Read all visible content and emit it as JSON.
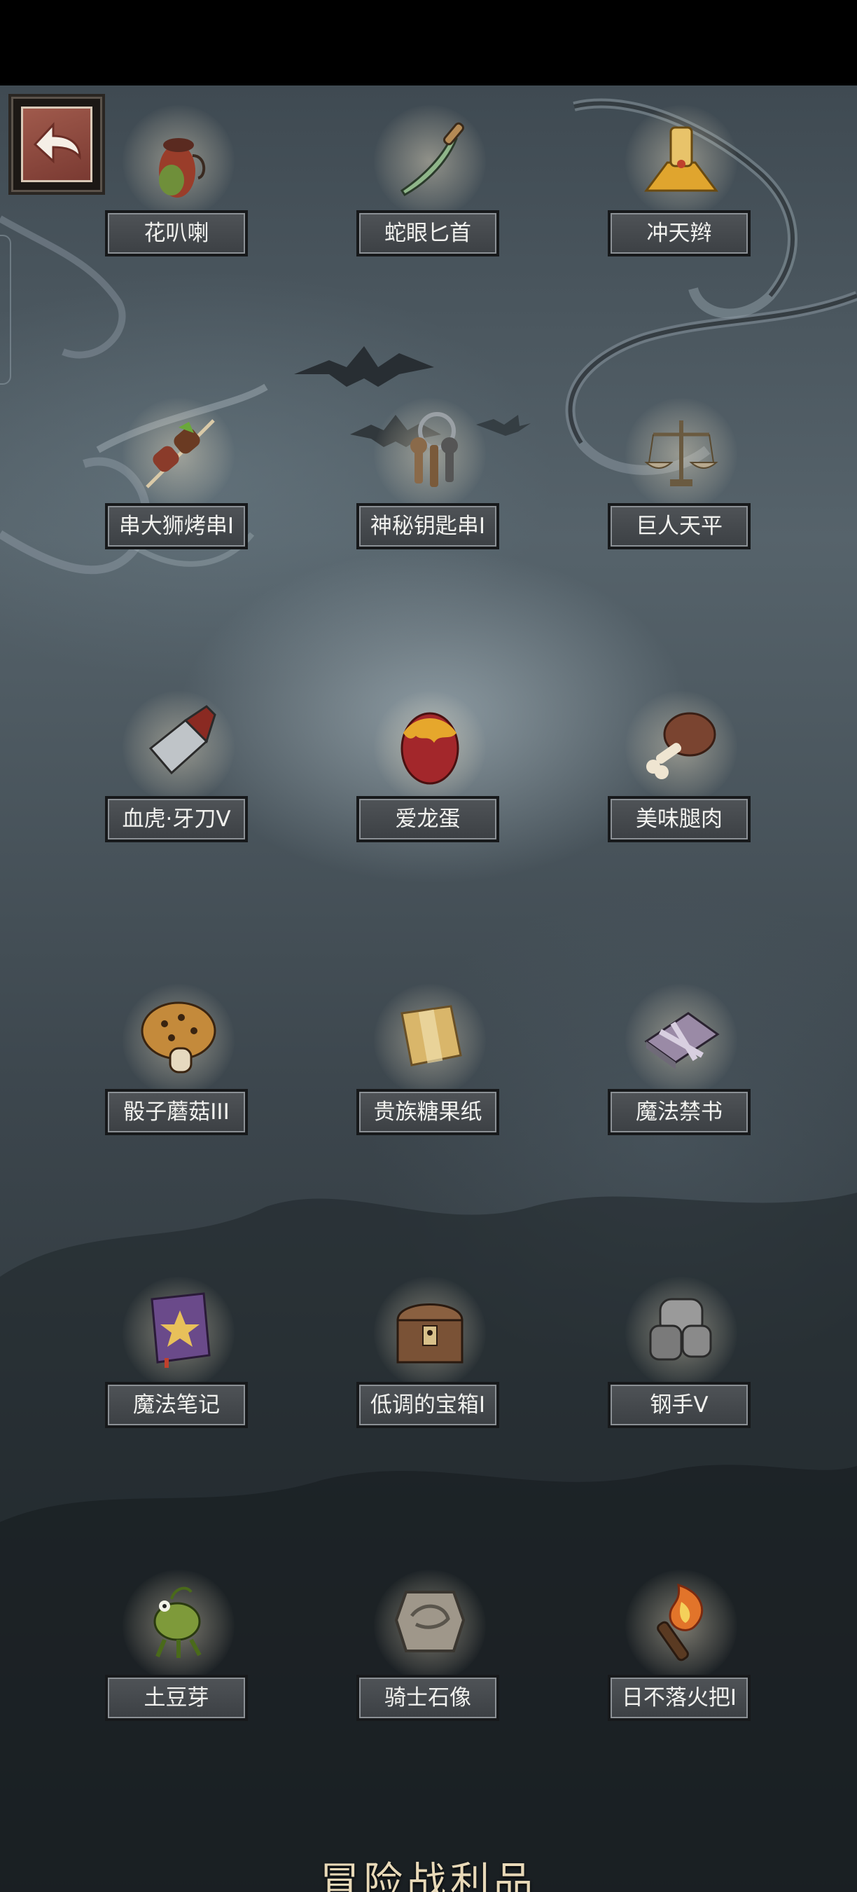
{
  "page": {
    "bottom_title": "冒险战利品"
  },
  "back_button": {
    "icon": "return-arrow-icon"
  },
  "items": [
    {
      "label": "花叭喇",
      "icon": "pitcher-plant-icon",
      "color": "#9a3d2a"
    },
    {
      "label": "蛇眼匕首",
      "icon": "dagger-icon",
      "color": "#8fb68a"
    },
    {
      "label": "冲天辫",
      "icon": "braid-icon",
      "color": "#e0a52e"
    },
    {
      "label": "串大狮烤串I",
      "icon": "skewer-icon",
      "color": "#8a3b2a"
    },
    {
      "label": "神秘钥匙串I",
      "icon": "keys-icon",
      "color": "#8a6a4a"
    },
    {
      "label": "巨人天平",
      "icon": "scales-icon",
      "color": "#b7a98f"
    },
    {
      "label": "血虎·牙刀V",
      "icon": "cleaver-icon",
      "color": "#bfc4c8"
    },
    {
      "label": "爱龙蛋",
      "icon": "dragon-egg-icon",
      "color": "#a3272b"
    },
    {
      "label": "美味腿肉",
      "icon": "meat-leg-icon",
      "color": "#7a4430"
    },
    {
      "label": "骰子蘑菇III",
      "icon": "mushroom-icon",
      "color": "#c48a3b"
    },
    {
      "label": "贵族糖果纸",
      "icon": "candy-wrapper-icon",
      "color": "#d9b66a"
    },
    {
      "label": "魔法禁书",
      "icon": "forbidden-book-icon",
      "color": "#9a8aa6"
    },
    {
      "label": "魔法笔记",
      "icon": "spellbook-icon",
      "color": "#6a4a8a"
    },
    {
      "label": "低调的宝箱I",
      "icon": "treasure-chest-icon",
      "color": "#7a5236"
    },
    {
      "label": "钢手V",
      "icon": "gauntlet-icon",
      "color": "#9a9a9a"
    },
    {
      "label": "土豆芽",
      "icon": "sprout-creature-icon",
      "color": "#7e9a3a"
    },
    {
      "label": "骑士石像",
      "icon": "stone-tablet-icon",
      "color": "#9f978a"
    },
    {
      "label": "日不落火把I",
      "icon": "torch-icon",
      "color": "#e2742a"
    }
  ]
}
